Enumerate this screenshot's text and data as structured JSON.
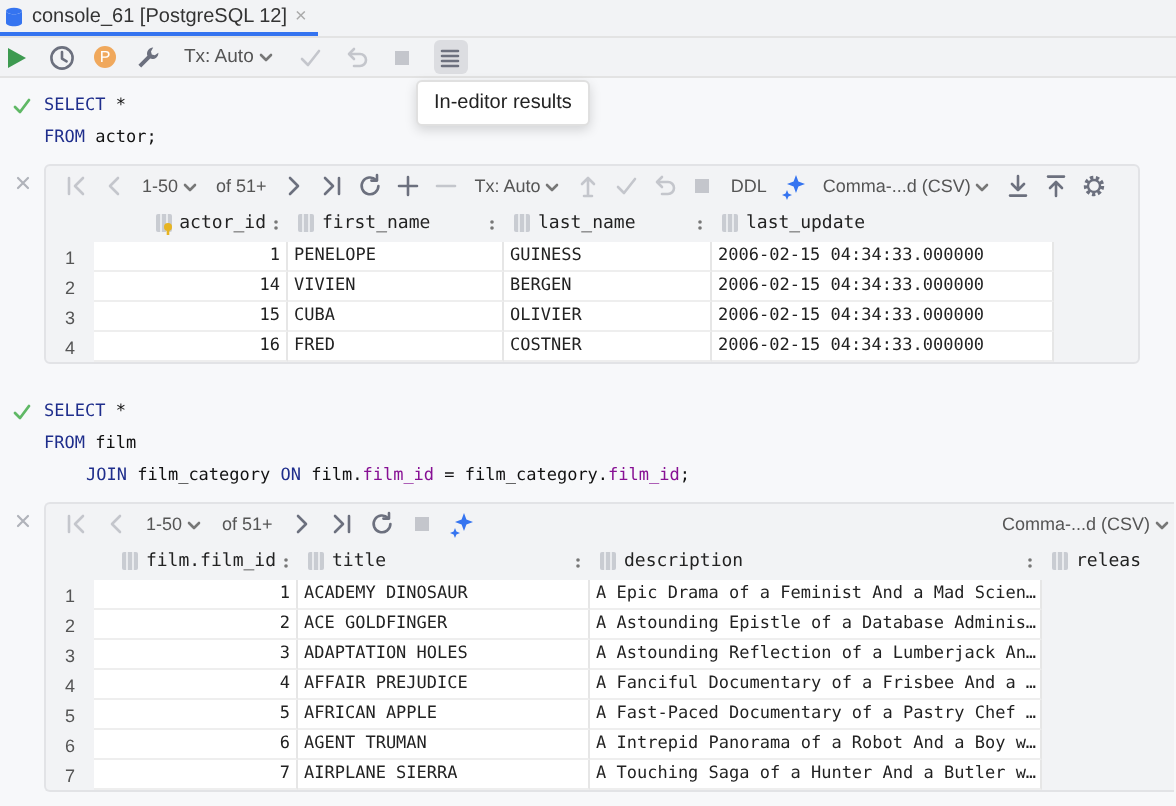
{
  "tab": {
    "title": "console_61 [PostgreSQL 12]",
    "close": "×",
    "selected": true
  },
  "toolbar": [
    {
      "kind": "run",
      "disabled": false
    },
    {
      "kind": "history",
      "disabled": false
    },
    {
      "kind": "profile",
      "label": "P"
    },
    {
      "kind": "settings",
      "disabled": false
    },
    {
      "kind": "tx",
      "label": "Tx: Auto",
      "disabled": false
    },
    {
      "kind": "commit",
      "disabled": true
    },
    {
      "kind": "rollback",
      "disabled": true
    },
    {
      "kind": "stop",
      "disabled": true
    },
    {
      "kind": "results",
      "disabled": false,
      "selected": true
    }
  ],
  "tooltip": "In-editor results",
  "queries": [
    {
      "succeeded": true,
      "lines": [
        {
          "indented": false,
          "tokens": [
            {
              "kind": "keyword",
              "text": "SELECT"
            },
            {
              "kind": "plain",
              "text": " *"
            }
          ]
        },
        {
          "indented": false,
          "tokens": [
            {
              "kind": "keyword",
              "text": "FROM"
            },
            {
              "kind": "plain",
              "text": " actor;"
            }
          ]
        }
      ],
      "results": {
        "toolbar": [
          {
            "kind": "first",
            "disabled": true
          },
          {
            "kind": "prev",
            "disabled": true
          },
          {
            "kind": "page",
            "label": "1-50"
          },
          {
            "kind": "count",
            "label": "of 51+"
          },
          {
            "kind": "next",
            "disabled": false
          },
          {
            "kind": "last",
            "disabled": false
          },
          {
            "kind": "reload",
            "disabled": false
          },
          {
            "kind": "add",
            "disabled": false
          },
          {
            "kind": "remove",
            "disabled": true
          },
          {
            "kind": "tx",
            "label": "Tx: Auto"
          },
          {
            "kind": "submit",
            "disabled": true
          },
          {
            "kind": "commit",
            "disabled": true
          },
          {
            "kind": "rollback",
            "disabled": true
          },
          {
            "kind": "stop",
            "disabled": true
          },
          {
            "kind": "ddl",
            "label": "DDL"
          },
          {
            "kind": "compare",
            "disabled": false
          },
          {
            "kind": "format",
            "label": "Comma-...d (CSV)"
          },
          {
            "kind": "download",
            "disabled": false
          },
          {
            "kind": "upload",
            "disabled": false
          },
          {
            "kind": "settings",
            "disabled": false
          }
        ],
        "columns": [
          {
            "label": "actor_id",
            "kind": "number",
            "primary_key": true
          },
          {
            "label": "first_name",
            "kind": "text",
            "primary_key": false
          },
          {
            "label": "last_name",
            "kind": "text",
            "primary_key": false
          },
          {
            "label": "last_update",
            "kind": "text",
            "primary_key": false
          }
        ],
        "rows": [
          {
            "number": "1",
            "cells": [
              "1",
              "PENELOPE",
              "GUINESS",
              "2006-02-15 04:34:33.000000"
            ]
          },
          {
            "number": "2",
            "cells": [
              "14",
              "VIVIEN",
              "BERGEN",
              "2006-02-15 04:34:33.000000"
            ]
          },
          {
            "number": "3",
            "cells": [
              "15",
              "CUBA",
              "OLIVIER",
              "2006-02-15 04:34:33.000000"
            ]
          },
          {
            "number": "4",
            "cells": [
              "16",
              "FRED",
              "COSTNER",
              "2006-02-15 04:34:33.000000"
            ]
          }
        ]
      }
    },
    {
      "succeeded": true,
      "lines": [
        {
          "indented": false,
          "tokens": [
            {
              "kind": "keyword",
              "text": "SELECT"
            },
            {
              "kind": "plain",
              "text": " *"
            }
          ]
        },
        {
          "indented": false,
          "tokens": [
            {
              "kind": "keyword",
              "text": "FROM"
            },
            {
              "kind": "plain",
              "text": " film"
            }
          ]
        },
        {
          "indented": true,
          "tokens": [
            {
              "kind": "keyword",
              "text": "JOIN"
            },
            {
              "kind": "plain",
              "text": " film_category "
            },
            {
              "kind": "keyword",
              "text": "ON"
            },
            {
              "kind": "plain",
              "text": " film."
            },
            {
              "kind": "field",
              "text": "film_id"
            },
            {
              "kind": "plain",
              "text": " = film_category."
            },
            {
              "kind": "field",
              "text": "film_id"
            },
            {
              "kind": "plain",
              "text": ";"
            }
          ]
        }
      ],
      "results": {
        "toolbar": [
          {
            "kind": "first",
            "disabled": true
          },
          {
            "kind": "prev",
            "disabled": true
          },
          {
            "kind": "page",
            "label": "1-50"
          },
          {
            "kind": "count",
            "label": "of 51+"
          },
          {
            "kind": "next",
            "disabled": false
          },
          {
            "kind": "last",
            "disabled": false
          },
          {
            "kind": "reload",
            "disabled": false
          },
          {
            "kind": "stop",
            "disabled": true
          },
          {
            "kind": "compare",
            "disabled": false
          },
          {
            "kind": "format",
            "label": "Comma-...d (CSV)"
          }
        ],
        "columns": [
          {
            "label": "film.film_id",
            "kind": "number",
            "primary_key": false
          },
          {
            "label": "title",
            "kind": "text",
            "primary_key": false
          },
          {
            "label": "description",
            "kind": "text",
            "primary_key": false
          },
          {
            "label": "releas",
            "kind": "text",
            "primary_key": false
          }
        ],
        "rows": [
          {
            "number": "1",
            "cells": [
              "1",
              "ACADEMY DINOSAUR",
              "A Epic Drama of a Feminist And a Mad Scien…"
            ]
          },
          {
            "number": "2",
            "cells": [
              "2",
              "ACE GOLDFINGER",
              "A Astounding Epistle of a Database Adminis…"
            ]
          },
          {
            "number": "3",
            "cells": [
              "3",
              "ADAPTATION HOLES",
              "A Astounding Reflection of a Lumberjack An…"
            ]
          },
          {
            "number": "4",
            "cells": [
              "4",
              "AFFAIR PREJUDICE",
              "A Fanciful Documentary of a Frisbee And a …"
            ]
          },
          {
            "number": "5",
            "cells": [
              "5",
              "AFRICAN APPLE",
              "A Fast-Paced Documentary of a Pastry Chef …"
            ]
          },
          {
            "number": "6",
            "cells": [
              "6",
              "AGENT TRUMAN",
              "A Intrepid Panorama of a Robot And a Boy w…"
            ]
          },
          {
            "number": "7",
            "cells": [
              "7",
              "AIRPLANE SIERRA",
              "A Touching Saga of a Hunter And a Butler w…"
            ]
          }
        ]
      }
    }
  ]
}
